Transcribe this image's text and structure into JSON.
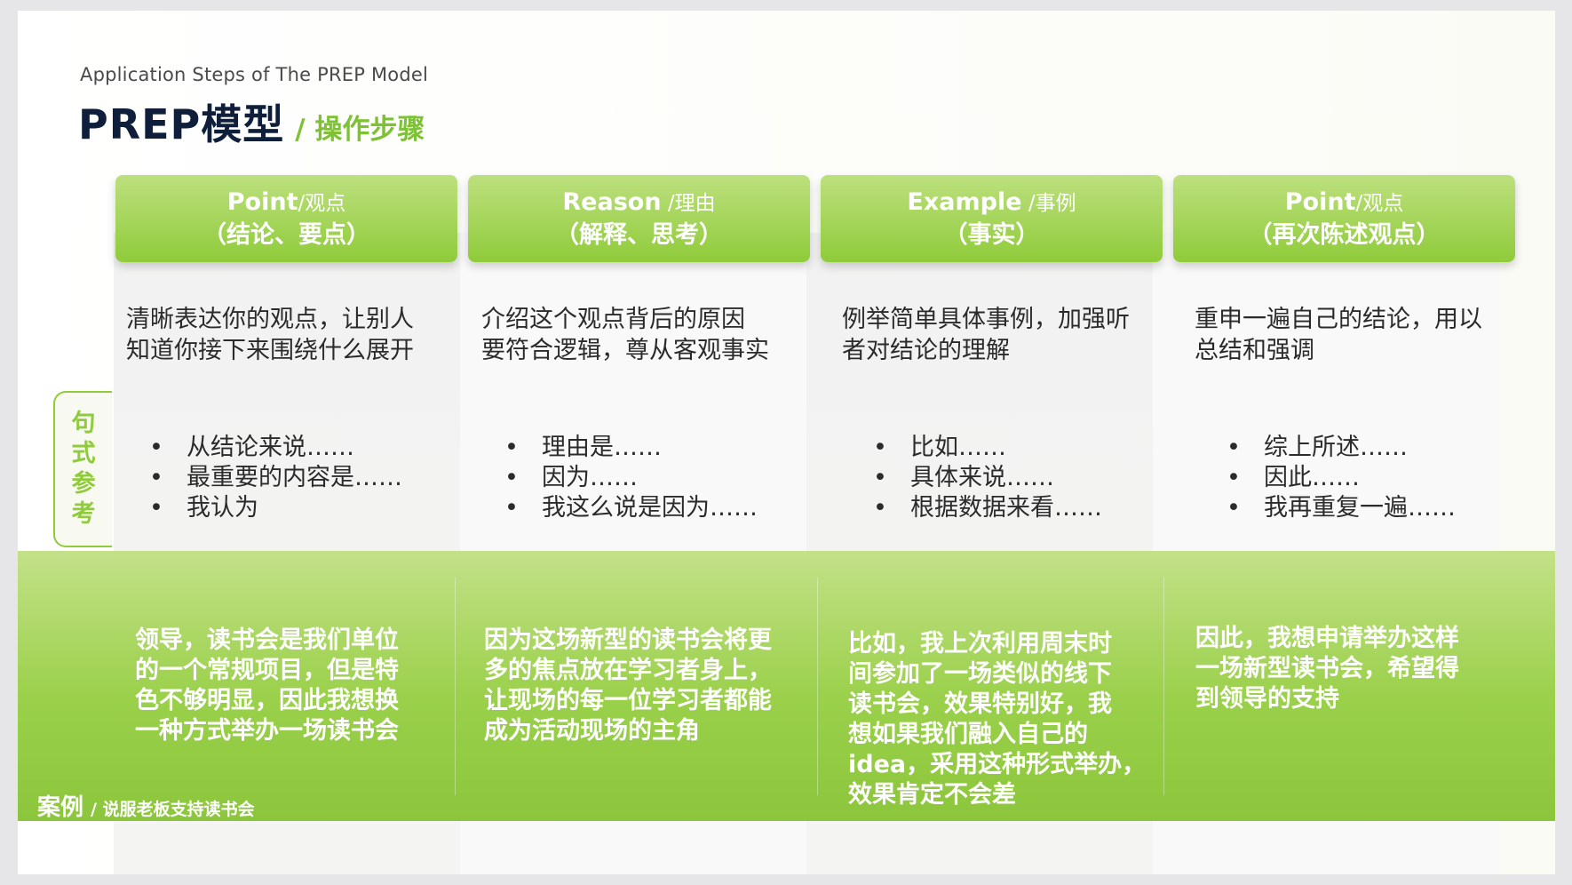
{
  "title": {
    "subtitle_en": "Application Steps of  The PREP Model",
    "main": "PREP模型",
    "sub": "/ 操作步骤"
  },
  "side_tag": [
    "句",
    "式",
    "参",
    "考"
  ],
  "columns": [
    {
      "header_en": "Point",
      "header_zh": "/观点",
      "header_line2": "（结论、要点）",
      "desc": [
        "清晰表达你的观点，让别人",
        "知道你接下来围绕什么展开"
      ],
      "bullets": [
        "从结论来说……",
        "最重要的内容是……",
        "我认为"
      ],
      "case": [
        "领导，读书会是我们单位",
        "的一个常规项目，但是特",
        "色不够明显，因此我想换",
        "一种方式举办一场读书会"
      ]
    },
    {
      "header_en": "Reason",
      "header_zh": " /理由",
      "header_line2": "（解释、思考）",
      "desc": [
        "介绍这个观点背后的原因",
        "要符合逻辑，尊从客观事实"
      ],
      "bullets": [
        "理由是……",
        "因为……",
        "我这么说是因为……"
      ],
      "case": [
        "因为这场新型的读书会将更",
        "多的焦点放在学习者身上，",
        "让现场的每一位学习者都能",
        "成为活动现场的主角"
      ]
    },
    {
      "header_en": "Example",
      "header_zh": " /事例",
      "header_line2": "（事实）",
      "desc": [
        "例举简单具体事例，加强听",
        "者对结论的理解"
      ],
      "bullets": [
        "比如……",
        "具体来说……",
        "根据数据来看……"
      ],
      "case": [
        "比如，我上次利用周末时",
        "间参加了一场类似的线下",
        "读书会，效果特别好，我",
        "想如果我们融入自己的",
        "idea，采用这种形式举办，",
        "效果肯定不会差"
      ]
    },
    {
      "header_en": "Point",
      "header_zh": "/观点",
      "header_line2": "（再次陈述观点）",
      "desc": [
        "重申一遍自己的结论，用以",
        "总结和强调"
      ],
      "bullets": [
        "综上所述……",
        "因此……",
        "我再重复一遍……"
      ],
      "case": [
        "因此，我想申请举办这样",
        "一场新型读书会，希望得",
        "到领导的支持"
      ]
    }
  ],
  "case_label": {
    "main": "案例",
    "sub": "/ 说服老板支持读书会"
  }
}
